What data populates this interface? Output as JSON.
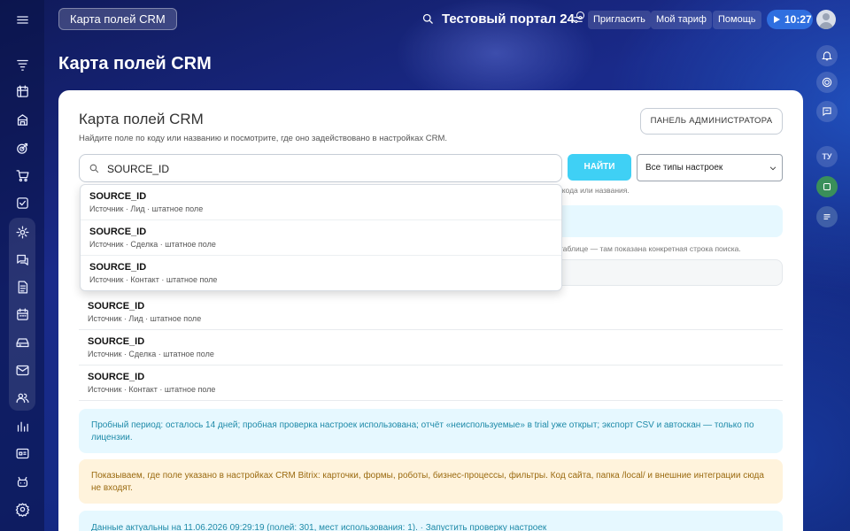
{
  "header": {
    "crm_button": "Карта полей CRM",
    "portal_title": "Тестовый портал",
    "portal_suffix": "24",
    "invite": "Пригласить",
    "tariff": "Мой тариф",
    "help": "Помощь",
    "time": "10:27"
  },
  "right_rail": {
    "initials": "ТУ"
  },
  "page": {
    "title": "Карта полей CRM"
  },
  "card": {
    "title": "Карта полей CRM",
    "subtitle": "Найдите поле по коду или названию и посмотрите, где оно задействовано в настройках CRM.",
    "admin_button": "ПАНЕЛЬ АДМИНИСТРАТОРА",
    "search_value": "SOURCE_ID",
    "find_button": "НАЙТИ",
    "type_select": "Все типы настроек",
    "hint_search": "ю кода или названия.",
    "hint_table": "таблице — там показана конкретная строка поиска."
  },
  "suggestions": [
    {
      "code": "SOURCE_ID",
      "meta": "Источник · Лид · штатное поле"
    },
    {
      "code": "SOURCE_ID",
      "meta": "Источник · Сделка · штатное поле"
    },
    {
      "code": "SOURCE_ID",
      "meta": "Источник · Контакт · штатное поле"
    }
  ],
  "results": [
    {
      "code": "SOURCE_ID",
      "meta": "Источник · Лид · штатное поле"
    },
    {
      "code": "SOURCE_ID",
      "meta": "Источник · Сделка · штатное поле"
    },
    {
      "code": "SOURCE_ID",
      "meta": "Источник · Контакт · штатное поле"
    }
  ],
  "alerts": {
    "trial": "Пробный период: осталось 14 дней; пробная проверка настроек использована; отчёт «неиспользуемые» в trial уже открыт; экспорт CSV и автоскан — только по лицензии.",
    "scope": "Показываем, где поле указано в настройках CRM Bitrix: карточки, формы, роботы, бизнес-процессы, фильтры. Код сайта, папка /local/ и внешние интеграции сюда не входят.",
    "data": "Данные актуальны на 11.06.2026 09:29:19 (полей: 301, мест использования: 1). · Запустить проверку настроек"
  }
}
